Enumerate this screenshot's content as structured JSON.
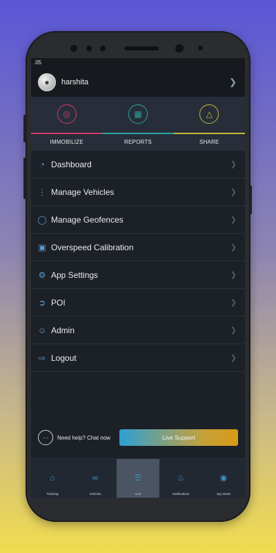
{
  "status": {
    "time": ".05"
  },
  "user": {
    "name": "harshita"
  },
  "quick_actions": [
    {
      "label": "IMMOBILIZE",
      "icon": "fingerprint-icon",
      "color": "#d43a6d"
    },
    {
      "label": "REPORTS",
      "icon": "reports-icon",
      "color": "#2aa39f"
    },
    {
      "label": "SHARE",
      "icon": "share-icon",
      "color": "#c6b735"
    }
  ],
  "menu": [
    {
      "label": "Dashboard",
      "icon": "dashboard-icon"
    },
    {
      "label": "Manage Vehicles",
      "icon": "vehicles-icon"
    },
    {
      "label": "Manage Geofences",
      "icon": "globe-icon"
    },
    {
      "label": "Overspeed Calibration",
      "icon": "car-icon"
    },
    {
      "label": "App Settings",
      "icon": "settings-icon"
    },
    {
      "label": "POI",
      "icon": "poi-icon"
    },
    {
      "label": "Admin",
      "icon": "admin-icon"
    },
    {
      "label": "Logout",
      "icon": "logout-icon"
    }
  ],
  "help": {
    "text": "Need help? Chat now",
    "button": "Live Support"
  },
  "tabs": [
    {
      "label": "Tracking",
      "icon": "home-icon"
    },
    {
      "label": "Vehicles",
      "icon": "link-icon"
    },
    {
      "label": "v1.0",
      "icon": "menu-icon"
    },
    {
      "label": "Notifications",
      "icon": "bell-icon"
    },
    {
      "label": "Spy Mode",
      "icon": "eye-icon"
    }
  ]
}
